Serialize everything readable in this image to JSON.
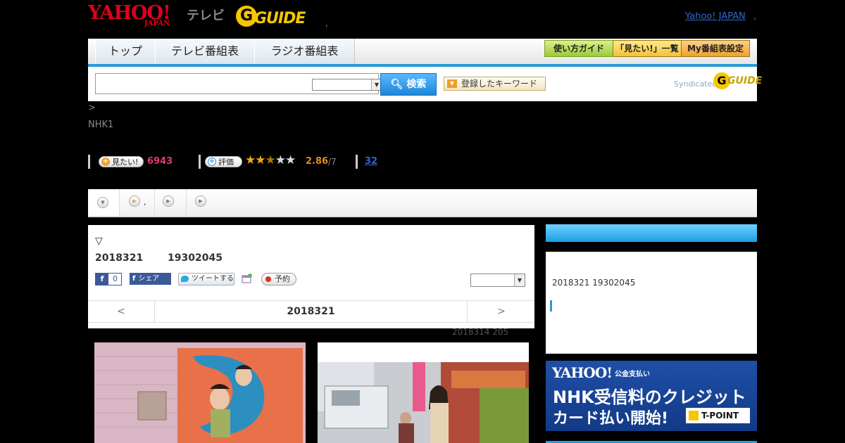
{
  "header": {
    "logo_yahoo": "YAHOO!",
    "logo_japan": "JAPAN",
    "logo_tv": "テレビ",
    "logo_gguide_g": "G",
    "logo_gguide_text": "GUIDE",
    "sep": ",",
    "yahoo_japan_link": "Yahoo! JAPAN",
    "trail": ","
  },
  "nav": {
    "tabs": [
      "トップ",
      "テレビ番組表",
      "ラジオ番組表"
    ],
    "buttons": [
      "使い方ガイド",
      "「見たい!」一覧",
      "My番組表設定"
    ]
  },
  "search": {
    "input_value": "",
    "select_value": "",
    "button_label": "検索",
    "keyword_button": "登録したキーワード",
    "syndicated": "Syndicated",
    "syndicated_logo": "GUIDE"
  },
  "breadcrumb": ">",
  "channel": "NHK1",
  "stats": {
    "mitai_label": "見たい!",
    "mitai_count": "6943",
    "rating_label": "評価",
    "stars": "★★★★★",
    "rating_value": "2.86",
    "rating_max": "/7",
    "review_count": "32"
  },
  "tabstrip": {
    "tab2_suffix": ","
  },
  "program": {
    "marker": "▽",
    "date": "2018321",
    "time": "19302045",
    "fb_count": "0",
    "share_label": "シェア",
    "tweet_label": "ツイートする",
    "reserve_label": "予約",
    "pager_prev": "<",
    "pager_date": "2018321",
    "pager_next": ">",
    "update_note": "2018314  205"
  },
  "sidebar": {
    "date_time": "2018321  19302045"
  },
  "ad": {
    "logo": "YAHOO!",
    "logo_sub": "公金支払い",
    "line1": "NHK受信料のクレジット",
    "line2": "カード払い開始!",
    "tpoint": "T-POINT"
  },
  "colors": {
    "accent_blue": "#2a9bd8",
    "yahoo_red": "#e0001b",
    "gguide_yellow": "#f6c600",
    "mitai_pink": "#e23a6a",
    "rating_orange": "#e08a1a"
  }
}
